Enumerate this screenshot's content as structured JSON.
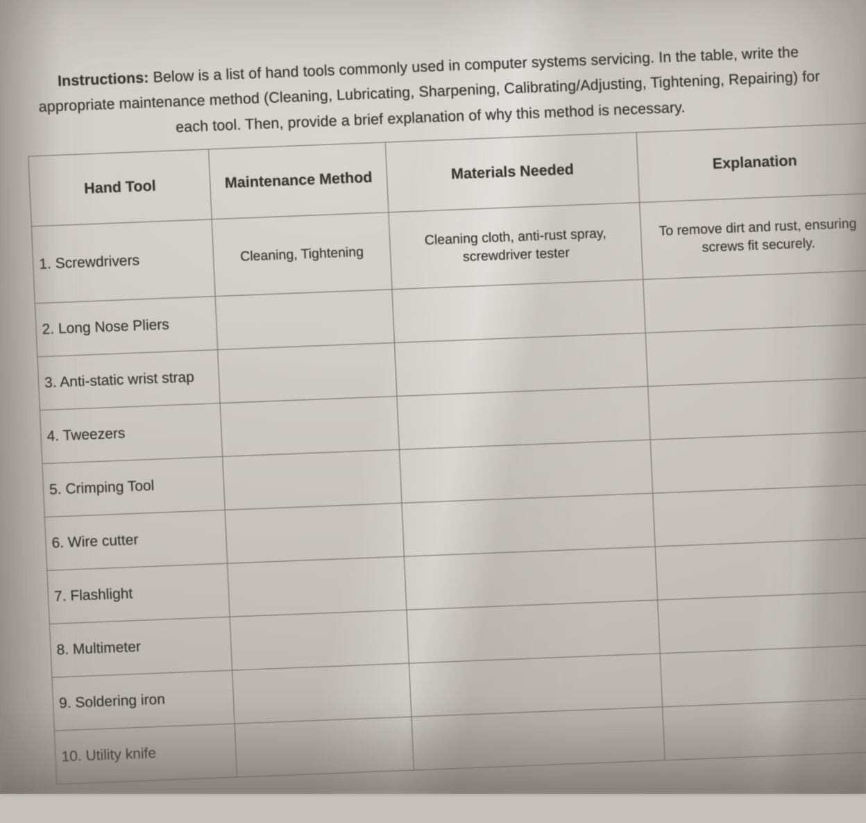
{
  "document": {
    "type": "worksheet-photo",
    "instructions_label": "Instructions:",
    "instructions_body": " Below is a list of hand tools commonly used in computer systems servicing. In the table, write the appropriate maintenance method (Cleaning, Lubricating, Sharpening, Calibrating/Adjusting, Tightening, Repairing) for each tool. Then, provide a brief explanation of why this method is necessary."
  },
  "colors": {
    "paper": "#c6c1bb",
    "ink": "#3a3733",
    "rule": "#6f6a64"
  },
  "table": {
    "headers": [
      "Hand Tool",
      "Maintenance Method",
      "Materials Needed",
      "Explanation"
    ],
    "rows": [
      {
        "tool": "1. Screwdrivers",
        "method": "Cleaning, Tightening",
        "materials": "Cleaning cloth, anti-rust spray, screwdriver tester",
        "explanation": "To remove dirt and rust, ensuring screws fit securely."
      },
      {
        "tool": "2. Long Nose Pliers",
        "method": "",
        "materials": "",
        "explanation": ""
      },
      {
        "tool": "3. Anti-static wrist strap",
        "method": "",
        "materials": "",
        "explanation": ""
      },
      {
        "tool": "4. Tweezers",
        "method": "",
        "materials": "",
        "explanation": ""
      },
      {
        "tool": "5. Crimping Tool",
        "method": "",
        "materials": "",
        "explanation": ""
      },
      {
        "tool": "6. Wire cutter",
        "method": "",
        "materials": "",
        "explanation": ""
      },
      {
        "tool": "7. Flashlight",
        "method": "",
        "materials": "",
        "explanation": ""
      },
      {
        "tool": "8. Multimeter",
        "method": "",
        "materials": "",
        "explanation": ""
      },
      {
        "tool": "9. Soldering iron",
        "method": "",
        "materials": "",
        "explanation": ""
      },
      {
        "tool": "10. Utility knife",
        "method": "",
        "materials": "",
        "explanation": ""
      }
    ]
  }
}
